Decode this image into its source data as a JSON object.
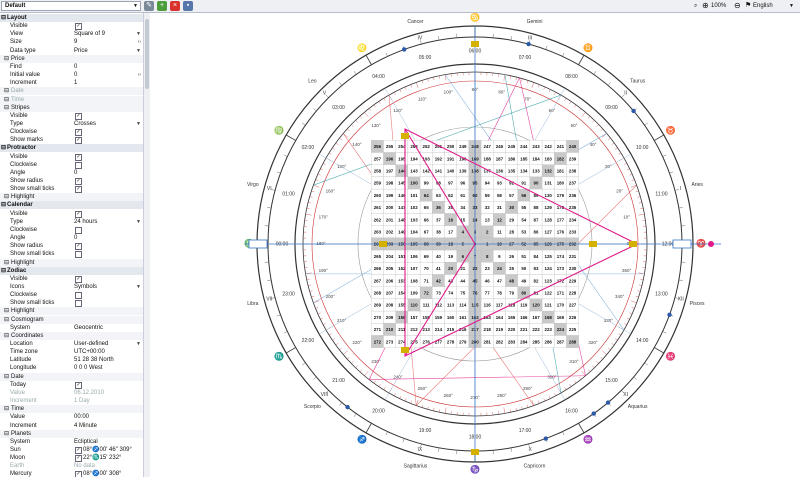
{
  "toolbar": {
    "preset": "Default",
    "zoom": "100%",
    "language": "English",
    "colors": {
      "add": "#4a9d3a",
      "delete": "#d9322c",
      "save": "#5577aa"
    }
  },
  "panel": {
    "rows": [
      {
        "label": "Layout",
        "kind": "sec"
      },
      {
        "label": "Visible",
        "check": true
      },
      {
        "label": "View",
        "value": "Square of 9",
        "dropdown": true
      },
      {
        "label": "Size",
        "value": "9",
        "spin": true
      },
      {
        "label": "Data type",
        "value": "Price",
        "dropdown": true
      },
      {
        "label": "Price",
        "kind": "sub"
      },
      {
        "label": "Find",
        "value": "0"
      },
      {
        "label": "Initial value",
        "value": "0",
        "spin": true
      },
      {
        "label": "Increment",
        "value": "1"
      },
      {
        "label": "Date",
        "kind": "sub",
        "dim": true
      },
      {
        "label": "Time",
        "kind": "sub",
        "dim": true
      },
      {
        "label": "Stripes",
        "kind": "sub"
      },
      {
        "label": "Visible",
        "check": true
      },
      {
        "label": "Type",
        "value": "Crosses",
        "dropdown": true
      },
      {
        "label": "Clockwise",
        "check": true
      },
      {
        "label": "Show marks",
        "check": true
      },
      {
        "label": "Protractor",
        "kind": "sec"
      },
      {
        "label": "Visible",
        "check": true
      },
      {
        "label": "Clockwise",
        "check": false
      },
      {
        "label": "Angle",
        "value": "0"
      },
      {
        "label": "Show radius",
        "check": true
      },
      {
        "label": "Show small ticks",
        "check": true
      },
      {
        "label": "Highlight",
        "kind": "sub"
      },
      {
        "label": "Calendar",
        "kind": "sec"
      },
      {
        "label": "Visible",
        "check": true
      },
      {
        "label": "Type",
        "value": "24 hours",
        "dropdown": true
      },
      {
        "label": "Clockwise",
        "check": false
      },
      {
        "label": "Angle",
        "value": "0"
      },
      {
        "label": "Show radius",
        "check": true
      },
      {
        "label": "Show small ticks",
        "check": false
      },
      {
        "label": "Highlight",
        "kind": "sub"
      },
      {
        "label": "Zodiac",
        "kind": "sec"
      },
      {
        "label": "Visible",
        "check": true
      },
      {
        "label": "Icons",
        "value": "Symbols",
        "dropdown": true
      },
      {
        "label": "Clockwise",
        "check": false
      },
      {
        "label": "Show small ticks",
        "check": false
      },
      {
        "label": "Highlight",
        "kind": "sub"
      },
      {
        "label": "Cosmogram",
        "kind": "sub"
      },
      {
        "label": "System",
        "value": "Geocentric"
      },
      {
        "label": "Coordinates",
        "kind": "sub"
      },
      {
        "label": "Location",
        "value": "User-defined",
        "dropdown": true
      },
      {
        "label": "Time zone",
        "value": "UTC+00:00"
      },
      {
        "label": "Latitude",
        "value": "51   28   38   North"
      },
      {
        "label": "Longitude",
        "value": "0   0   0   West"
      },
      {
        "label": "Date",
        "kind": "sub"
      },
      {
        "label": "Today",
        "check": true
      },
      {
        "label": "Value",
        "value": "06.12.2010",
        "dim": true
      },
      {
        "label": "Increment",
        "value": "1   Day",
        "dim": true
      },
      {
        "label": "Time",
        "kind": "sub"
      },
      {
        "label": "Value",
        "value": "00:00"
      },
      {
        "label": "Increment",
        "value": "4   Minute"
      },
      {
        "label": "Planets",
        "kind": "sub"
      },
      {
        "label": "System",
        "value": "Ecliptical"
      },
      {
        "label": "Sun",
        "value": "08°♐00' 46\" 309°",
        "check": true
      },
      {
        "label": "Moon",
        "value": "22°♏15' 232°",
        "check": true
      },
      {
        "label": "Earth",
        "value": "No data",
        "dim": true
      },
      {
        "label": "Mercury",
        "value": "08°♐00' 308°",
        "check": true
      }
    ]
  },
  "chart": {
    "signs_text": [
      "Cancer",
      "Gemini",
      "Taurus",
      "Aries",
      "Pisces",
      "Aquarius",
      "Capricorn",
      "Sagittarius",
      "Scorpio",
      "Libra",
      "Virgo",
      "Leo"
    ],
    "sign_glyphs": [
      "♋",
      "♊",
      "♉",
      "♈",
      "♓",
      "♒",
      "♑",
      "♐",
      "♏",
      "♎",
      "♍",
      "♌"
    ],
    "roman": [
      "IV",
      "III",
      "II",
      "I",
      "XII",
      "XI",
      "X",
      "IX",
      "VIII",
      "VII",
      "VI",
      "V"
    ],
    "hours": [
      "00:00",
      "01:00",
      "02:00",
      "03:00",
      "04:00",
      "05:00",
      "06:00",
      "07:00",
      "08:00",
      "09:00",
      "10:00",
      "11:00",
      "12:00",
      "13:00",
      "14:00",
      "15:00",
      "16:00",
      "17:00",
      "18:00",
      "19:00",
      "20:00",
      "21:00",
      "22:00",
      "23:00"
    ],
    "degrees": [
      "0°",
      "10°",
      "20°",
      "30°",
      "40°",
      "50°",
      "60°",
      "70°",
      "80°",
      "90°",
      "100°",
      "110°",
      "120°",
      "130°",
      "140°",
      "150°",
      "160°",
      "170°",
      "180°",
      "190°",
      "200°",
      "210°",
      "220°",
      "230°",
      "240°",
      "250°",
      "260°",
      "270°",
      "280°",
      "290°",
      "300°",
      "310°",
      "320°",
      "330°",
      "340°",
      "350°"
    ],
    "grid_size": 17,
    "center_value": 0,
    "colors": {
      "accent": "#e0198a",
      "blue": "#3a78c8",
      "gold": "#d4b000",
      "teal": "#2a9aa0",
      "shade": "#c9c9c9"
    }
  }
}
